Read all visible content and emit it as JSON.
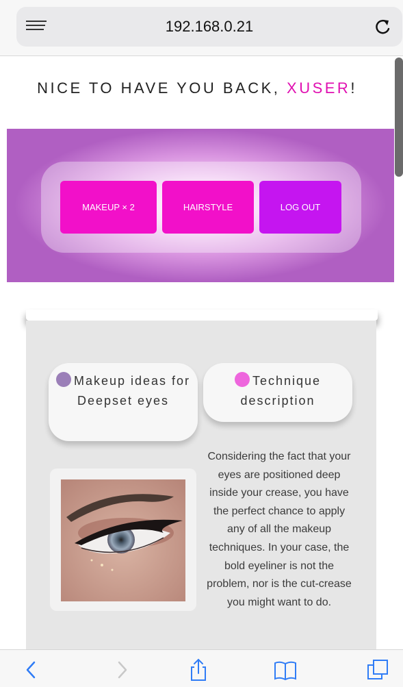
{
  "browser": {
    "url": "192.168.0.21"
  },
  "greeting": {
    "prefix": "NICE TO HAVE YOU BACK, ",
    "username": "XUSER",
    "suffix": "!"
  },
  "nav": {
    "makeup_label": "MAKEUP × 2",
    "hairstyle_label": "HAIRSTYLE",
    "logout_label": "LOG OUT"
  },
  "cards": {
    "ideas_label": "Makeup ideas for Deepset eyes",
    "technique_label": "Technique description"
  },
  "description": "Considering the fact that your eyes are positioned deep inside your crease, you have the perfect chance to apply any of all the makeup techniques. In your case, the bold eyeliner is not the problem, nor is the cut-crease you might want to do.",
  "icons": {
    "menu": "menu-icon",
    "reload": "reload-icon",
    "ideas": "makeup-icon",
    "technique": "brush-icon",
    "back": "back-icon",
    "forward": "forward-icon",
    "share": "share-icon",
    "bookmarks": "book-icon",
    "tabs": "tabs-icon"
  },
  "colors": {
    "accent_pink": "#f210c9",
    "accent_purple": "#c515f0",
    "username": "#e00fb1",
    "toolbar_blue": "#2f7cf6"
  }
}
